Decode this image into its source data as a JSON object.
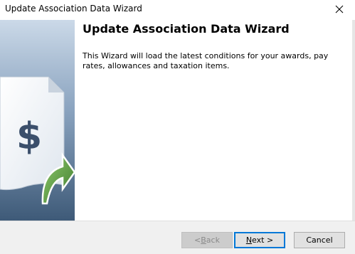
{
  "window": {
    "title": "Update Association Data Wizard",
    "close_glyph": "×"
  },
  "side_panel": {
    "icon": "dollar-document-icon",
    "symbol": "$",
    "arrow_icon": "green-curved-arrow-icon",
    "colors": {
      "gradient_top": "#c7d6e6",
      "gradient_bottom": "#3f5c7a",
      "symbol": "#3b4f6b",
      "arrow": "#4f8b3a"
    }
  },
  "content": {
    "heading": "Update Association Data Wizard",
    "description": "This Wizard will load the latest conditions for your awards, pay rates, allowances and taxation items."
  },
  "buttons": {
    "back": {
      "prefix": "< ",
      "mnemonic": "B",
      "rest": "ack",
      "enabled": false
    },
    "next": {
      "mnemonic": "N",
      "rest": "ext >",
      "focused": true
    },
    "cancel": {
      "label": "Cancel"
    }
  }
}
